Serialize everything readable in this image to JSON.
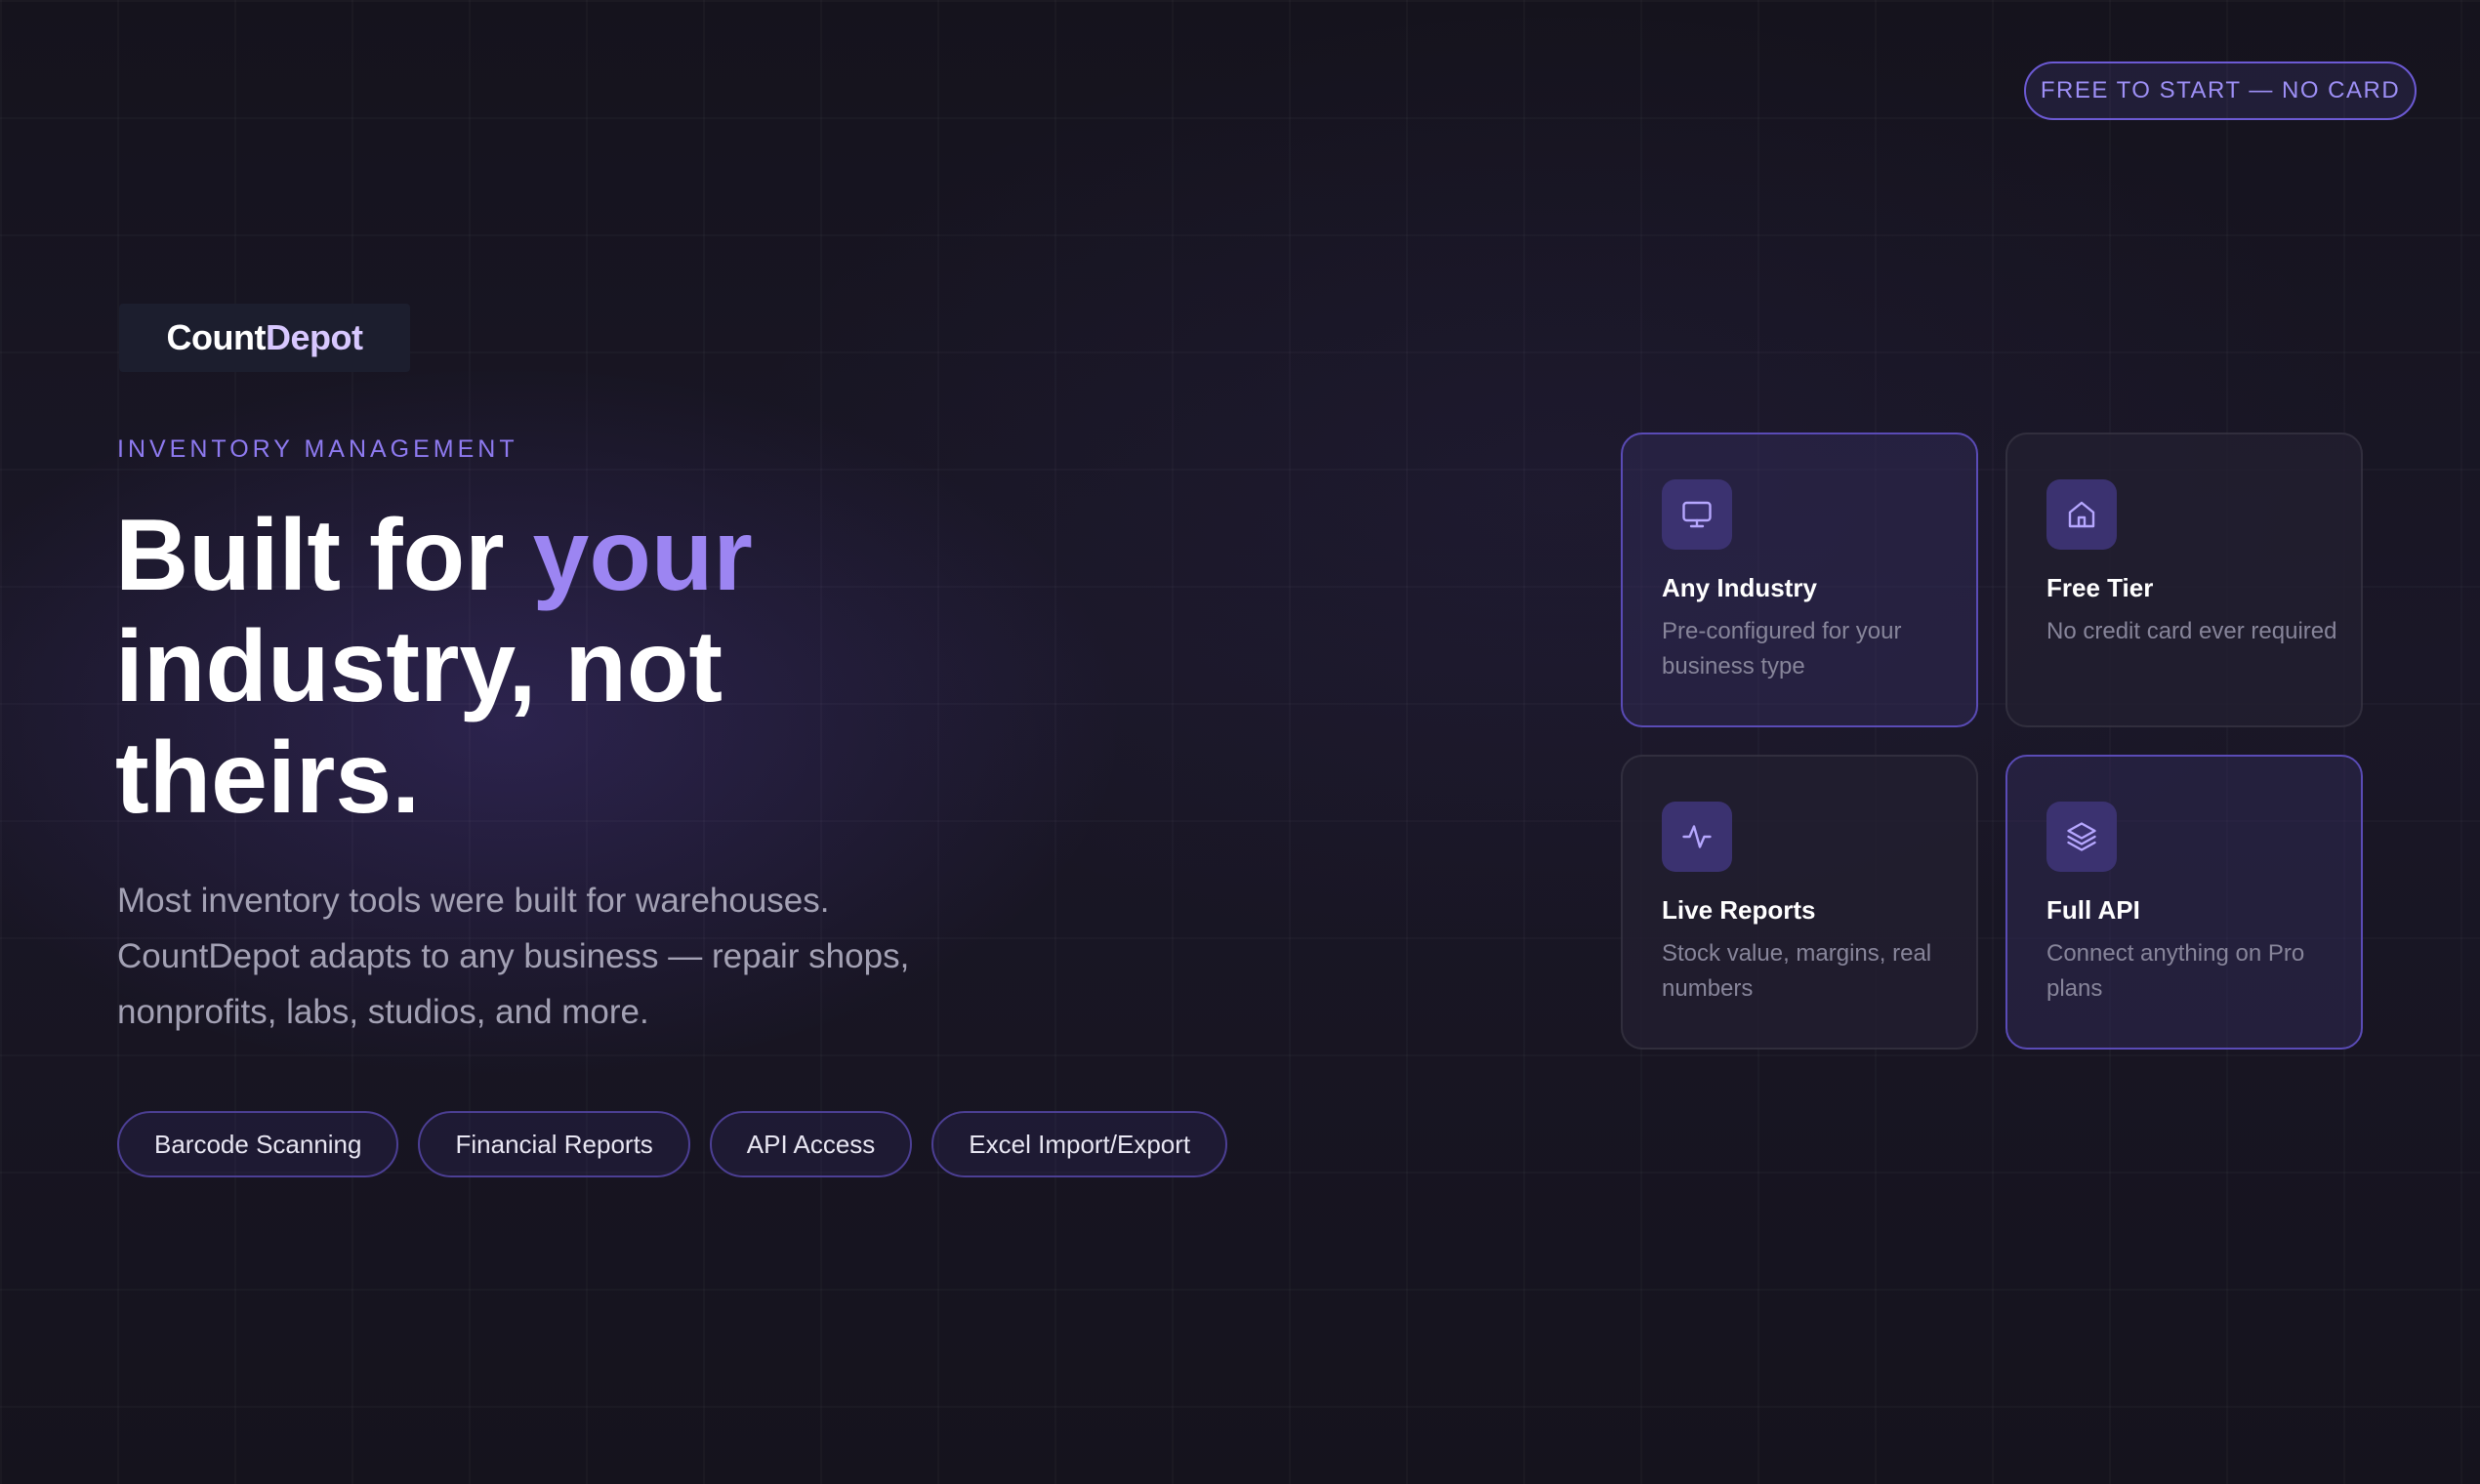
{
  "badge": {
    "label": "FREE TO START — NO CARD"
  },
  "brand": {
    "name_part1": "Count",
    "name_part2": "Depot"
  },
  "hero": {
    "eyebrow": "INVENTORY MANAGEMENT",
    "headline_part1": "Built for ",
    "headline_accent": "your",
    "headline_part2": "industry, not theirs.",
    "description": "Most inventory tools were built for warehouses. CountDepot adapts to any business — repair shops, nonprofits, labs, studios, and more."
  },
  "chips": [
    {
      "label": "Barcode Scanning"
    },
    {
      "label": "Financial Reports"
    },
    {
      "label": "API Access"
    },
    {
      "label": "Excel Import/Export"
    }
  ],
  "cards": [
    {
      "icon": "monitor-icon",
      "title": "Any Industry",
      "desc": "Pre-configured for your business type"
    },
    {
      "icon": "home-icon",
      "title": "Free Tier",
      "desc": "No credit card ever required"
    },
    {
      "icon": "activity-icon",
      "title": "Live Reports",
      "desc": "Stock value, margins, real numbers"
    },
    {
      "icon": "layers-icon",
      "title": "Full API",
      "desc": "Connect anything on Pro plans"
    }
  ],
  "colors": {
    "background": "#14121c",
    "accent": "#9c85f2",
    "badge_border": "#6c5ad4",
    "muted_text": "#a3a1b4"
  }
}
